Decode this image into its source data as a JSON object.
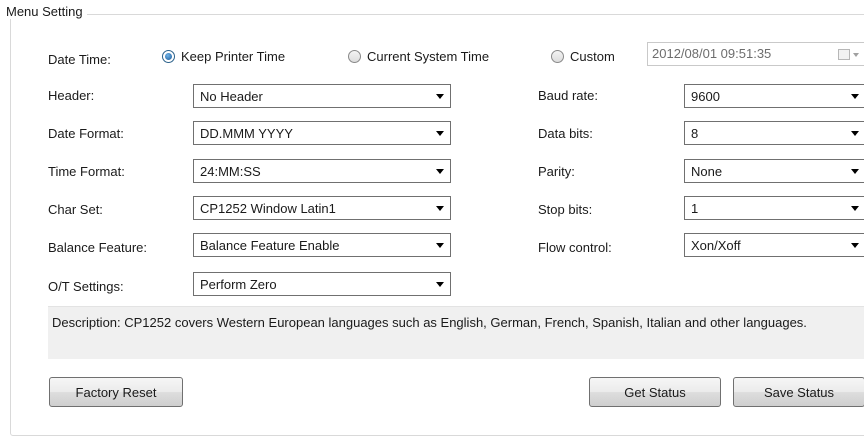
{
  "group_title": "Menu Setting",
  "date_time": {
    "label": "Date Time:",
    "options": [
      "Keep Printer Time",
      "Current System Time",
      "Custom"
    ],
    "selected": "Keep Printer Time",
    "custom_value": "2012/08/01 09:51:35",
    "icons": [
      "calendar-icon",
      "chevron-down-icon"
    ]
  },
  "left_fields": [
    {
      "label": "Header:",
      "value": "No Header"
    },
    {
      "label": "Date Format:",
      "value": "DD.MMM YYYY"
    },
    {
      "label": "Time Format:",
      "value": "24:MM:SS"
    },
    {
      "label": "Char Set:",
      "value": "CP1252 Window Latin1"
    },
    {
      "label": "Balance Feature:",
      "value": "Balance Feature Enable"
    },
    {
      "label": "O/T Settings:",
      "value": "Perform Zero"
    }
  ],
  "right_fields": [
    {
      "label": "Baud rate:",
      "value": "9600"
    },
    {
      "label": "Data bits:",
      "value": "8"
    },
    {
      "label": "Parity:",
      "value": "None"
    },
    {
      "label": "Stop bits:",
      "value": "1"
    },
    {
      "label": "Flow control:",
      "value": "Xon/Xoff"
    }
  ],
  "description": "Description: CP1252 covers Western European languages such as English, German, French, Spanish, Italian and other languages.",
  "buttons": {
    "factory_reset": "Factory Reset",
    "get_status": "Get Status",
    "save_status": "Save Status"
  }
}
